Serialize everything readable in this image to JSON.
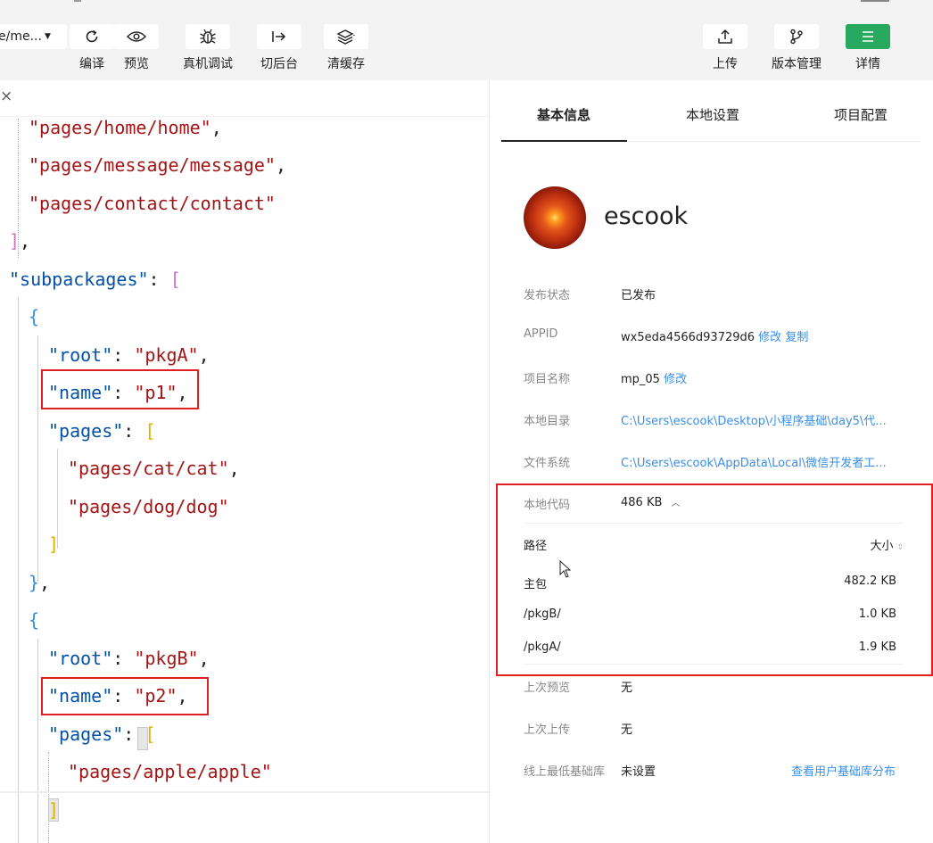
{
  "toolbar": {
    "path_select": "e/me...",
    "buttons": {
      "compile": "编译",
      "preview": "预览",
      "real_debug": "真机调试",
      "background": "切后台",
      "clear_cache": "清缓存",
      "upload": "上传",
      "version": "版本管理",
      "details": "详情"
    }
  },
  "editor": {
    "close_tab": "×",
    "lines": {
      "l1": "\"pages/home/home\"",
      "l1_tail": ",",
      "l2": "\"pages/message/message\"",
      "l2_tail": ",",
      "l3": "\"pages/contact/contact\"",
      "l4_brk": "]",
      "l4_tail": ",",
      "l5_key": "\"subpackages\"",
      "l5_colon": ": ",
      "l5_brk": "[",
      "l6": "{",
      "l7_key": "\"root\"",
      "l7_colon": ": ",
      "l7_val": "\"pkgA\"",
      "l7_tail": ",",
      "l8_key": "\"name\"",
      "l8_colon": ": ",
      "l8_val": "\"p1\"",
      "l8_tail": ",",
      "l9_key": "\"pages\"",
      "l9_colon": ": ",
      "l9_brk": "[",
      "l10": "\"pages/cat/cat\"",
      "l10_tail": ",",
      "l11": "\"pages/dog/dog\"",
      "l12": "]",
      "l13": "}",
      "l13_tail": ",",
      "l14": "{",
      "l15_key": "\"root\"",
      "l15_colon": ": ",
      "l15_val": "\"pkgB\"",
      "l15_tail": ",",
      "l16_key": "\"name\"",
      "l16_colon": ": ",
      "l16_val": "\"p2\"",
      "l16_tail": ",",
      "l17_key": "\"pages\"",
      "l17_colon": ": ",
      "l17_brk": "[",
      "l18": "\"pages/apple/apple\"",
      "l19": "]"
    }
  },
  "panel": {
    "tabs": [
      "基本信息",
      "本地设置",
      "项目配置"
    ],
    "username": "escook",
    "fields": {
      "publish_status": {
        "label": "发布状态",
        "value": "已发布"
      },
      "appid": {
        "label": "APPID",
        "value": "wx5eda4566d93729d6",
        "link1": "修改",
        "link2": "复制"
      },
      "project_name": {
        "label": "项目名称",
        "value": "mp_05",
        "link": "修改"
      },
      "local_dir": {
        "label": "本地目录",
        "value": "C:\\Users\\escook\\Desktop\\小程序基础\\day5\\代..."
      },
      "file_system": {
        "label": "文件系统",
        "value": "C:\\Users\\escook\\AppData\\Local\\微信开发者工..."
      },
      "local_code": {
        "label": "本地代码",
        "value": "486 KB"
      },
      "last_preview": {
        "label": "上次预览",
        "value": "无"
      },
      "last_upload": {
        "label": "上次上传",
        "value": "无"
      },
      "min_lib": {
        "label": "线上最低基础库",
        "value": "未设置",
        "link": "查看用户基础库分布"
      }
    },
    "size_table": {
      "col_path": "路径",
      "col_size": "大小",
      "rows": [
        {
          "path": "主包",
          "size": "482.2 KB"
        },
        {
          "path": "/pkgB/",
          "size": "1.0 KB"
        },
        {
          "path": "/pkgA/",
          "size": "1.9 KB"
        }
      ]
    }
  }
}
